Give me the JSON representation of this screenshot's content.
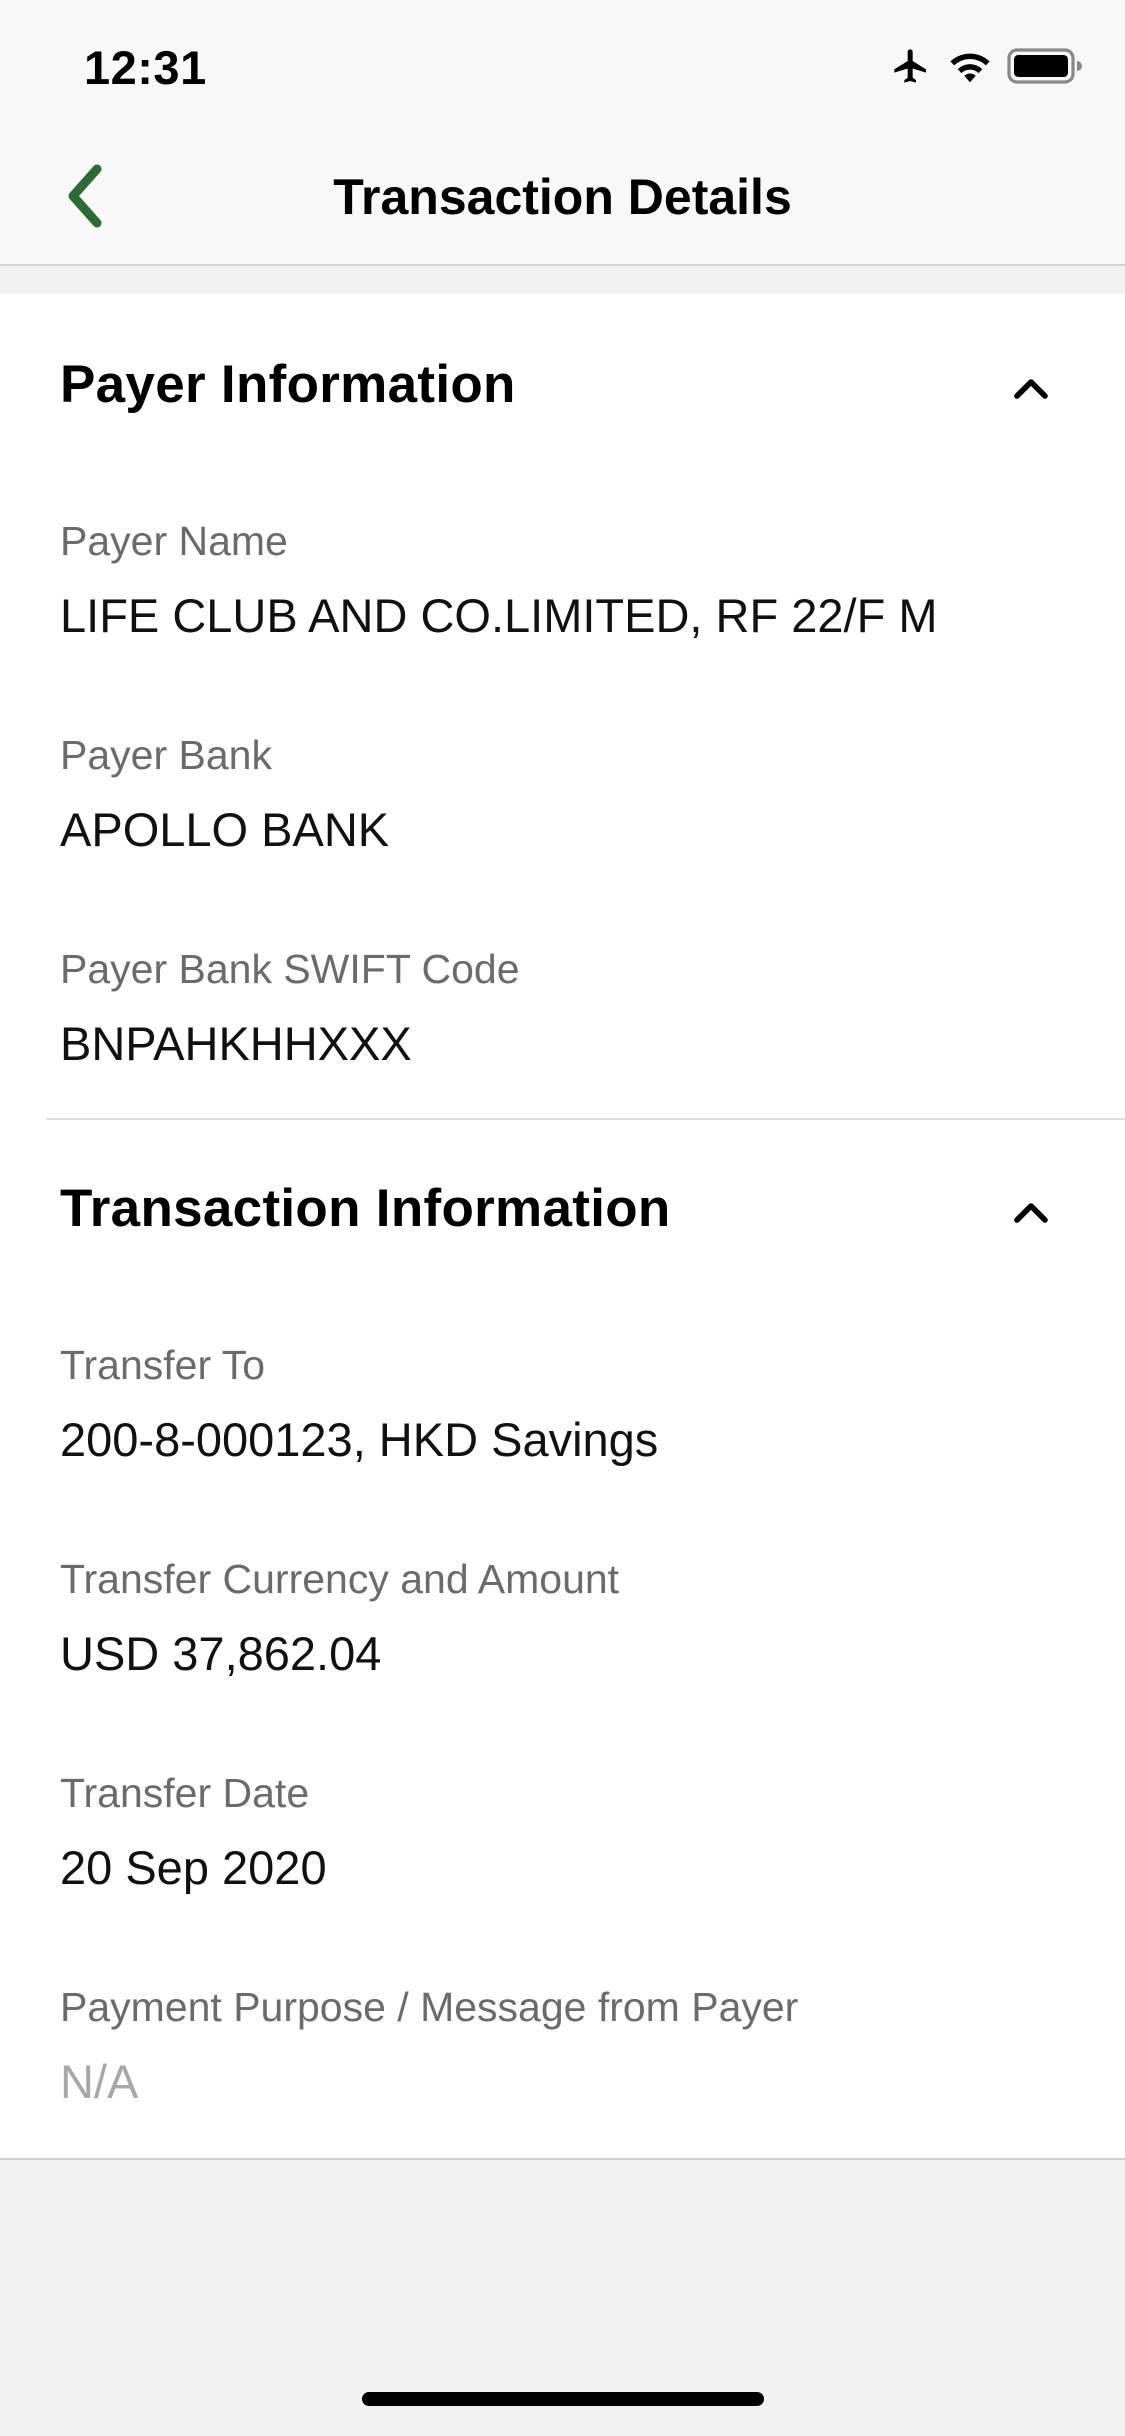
{
  "status_bar": {
    "time": "12:31",
    "icons": [
      "airplane-icon",
      "wifi-icon",
      "battery-icon"
    ]
  },
  "nav": {
    "back_icon": "chevron-left-icon",
    "title": "Transaction Details",
    "accent_color": "#2e6b34"
  },
  "sections": [
    {
      "title": "Payer Information",
      "expanded": true,
      "fields": [
        {
          "label": "Payer Name",
          "value": "LIFE CLUB AND CO.LIMITED, RF 22/F M"
        },
        {
          "label": "Payer Bank",
          "value": "APOLLO BANK"
        },
        {
          "label": "Payer Bank SWIFT Code",
          "value": "BNPAHKHHXXX"
        }
      ]
    },
    {
      "title": "Transaction Information",
      "expanded": true,
      "fields": [
        {
          "label": "Transfer To",
          "value": "200-8-000123, HKD Savings"
        },
        {
          "label": "Transfer Currency and Amount",
          "value": "USD 37,862.04"
        },
        {
          "label": "Transfer Date",
          "value": "20 Sep 2020"
        },
        {
          "label": "Payment Purpose / Message from Payer",
          "value": "N/A"
        }
      ]
    }
  ]
}
